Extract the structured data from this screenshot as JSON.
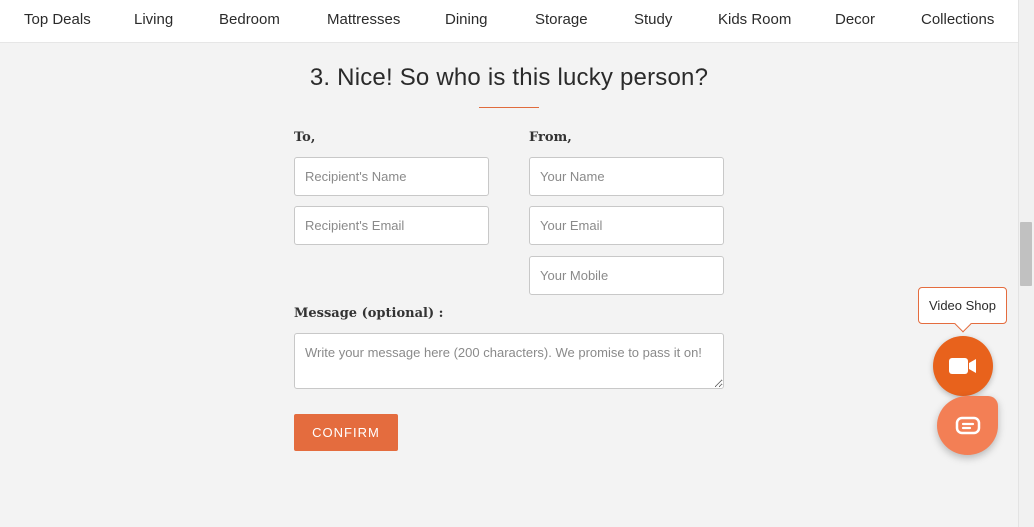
{
  "nav": {
    "items": [
      "Top Deals",
      "Living",
      "Bedroom",
      "Mattresses",
      "Dining",
      "Storage",
      "Study",
      "Kids Room",
      "Decor",
      "Collections"
    ]
  },
  "form": {
    "heading": "3. Nice! So who is this lucky person?",
    "to_label": "To,",
    "from_label": "From,",
    "recipient_name_placeholder": "Recipient's Name",
    "recipient_email_placeholder": "Recipient's Email",
    "your_name_placeholder": "Your Name",
    "your_email_placeholder": "Your Email",
    "your_mobile_placeholder": "Your Mobile",
    "message_label": "Message (optional) :",
    "message_placeholder": "Write your message here (200 characters). We promise to pass it on!",
    "confirm_label": "CONFIRM"
  },
  "widgets": {
    "video_shop_label": "Video Shop",
    "video_icon": "video-camera-icon",
    "chat_icon": "chat-bubble-icon"
  },
  "colors": {
    "accent": "#e46c3e",
    "video_button": "#e8621c",
    "chat_button": "#f37f55",
    "background": "#f3f3f3"
  }
}
